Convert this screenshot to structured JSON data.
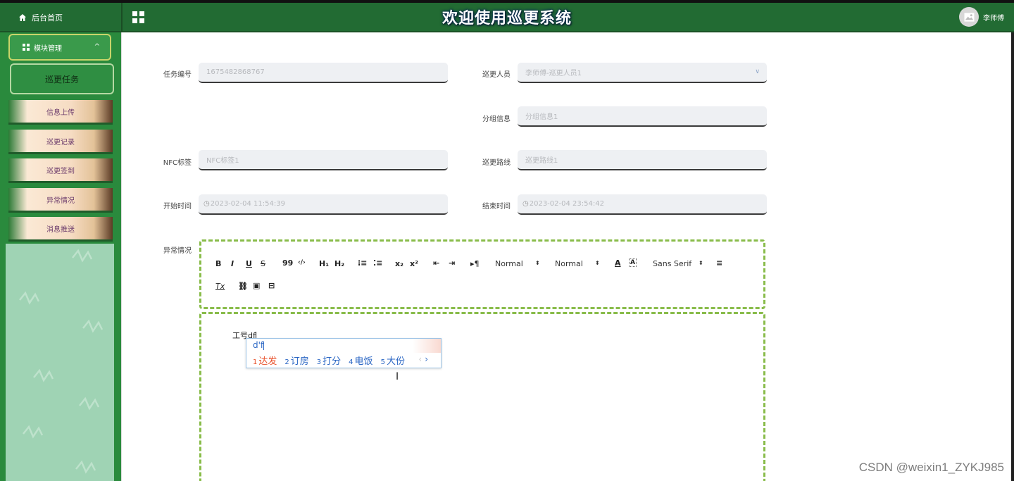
{
  "header": {
    "home_label": "后台首页",
    "title": "欢迎使用巡更系统",
    "username": "李师傅",
    "accent_color": "#226b33"
  },
  "sidebar": {
    "menu_head": "模块管理",
    "active_item": "巡更任务",
    "sub_items": [
      {
        "label": "信息上传"
      },
      {
        "label": "巡更记录"
      },
      {
        "label": "巡更签到"
      },
      {
        "label": "异常情况"
      },
      {
        "label": "消息推送"
      }
    ]
  },
  "form": {
    "task_no": {
      "label": "任务编号",
      "value": "1675482868767"
    },
    "patrol_person": {
      "label": "巡更人员",
      "value": "李师傅-巡更人员1"
    },
    "group_info": {
      "label": "分组信息",
      "value": "分组信息1"
    },
    "nfc_tag": {
      "label": "NFC标签",
      "value": "NFC标签1"
    },
    "patrol_route": {
      "label": "巡更路线",
      "value": "巡更路线1"
    },
    "start_time": {
      "label": "开始时间",
      "value": "2023-02-04 11:54:39"
    },
    "end_time": {
      "label": "结束时间",
      "value": "2023-02-04 23:54:42"
    },
    "exception": {
      "label": "异常情况"
    }
  },
  "editor": {
    "toolbar": {
      "bold": "B",
      "italic": "I",
      "underline": "U",
      "strike": "S",
      "quote": "99",
      "code": "‹/›",
      "h1": "H₁",
      "h2": "H₂",
      "sub": "x₂",
      "sup": "x²",
      "direction": "▸¶",
      "size_select": "Normal",
      "header_select": "Normal",
      "font_select": "Sans Serif",
      "clean": "Tx"
    },
    "content": "工号df"
  },
  "ime": {
    "pinyin": "d'f",
    "candidates": [
      {
        "num": "1",
        "text": "达发"
      },
      {
        "num": "2",
        "text": "订房"
      },
      {
        "num": "3",
        "text": "打分"
      },
      {
        "num": "4",
        "text": "电饭"
      },
      {
        "num": "5",
        "text": "大份"
      }
    ],
    "prev": "‹",
    "next": "›"
  },
  "watermark": "CSDN @weixin1_ZYKJ985"
}
